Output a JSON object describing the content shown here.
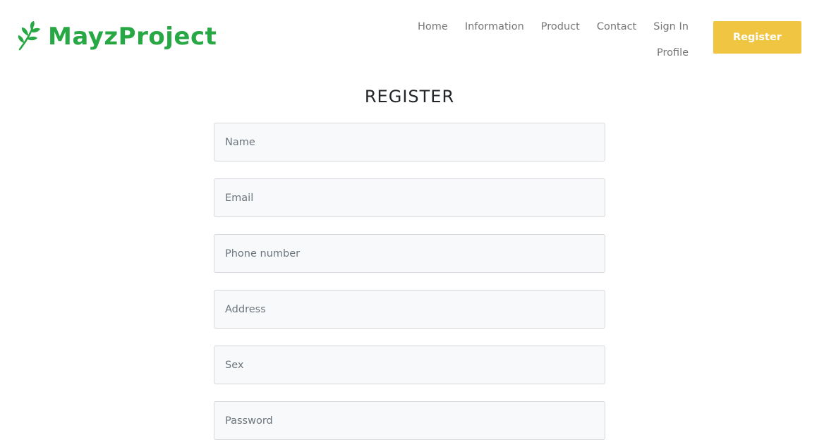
{
  "brand": {
    "name": "MayzProject",
    "icon": "leaf-sprig-icon",
    "color": "#28a745"
  },
  "nav": {
    "items": [
      {
        "label": "Home"
      },
      {
        "label": "Information"
      },
      {
        "label": "Product"
      },
      {
        "label": "Contact"
      },
      {
        "label": "Sign In"
      },
      {
        "label": "Profile"
      }
    ],
    "color": "#777777"
  },
  "header_button": {
    "label": "Register",
    "color": "#f0c541"
  },
  "form": {
    "title": "REGISTER",
    "fields": [
      {
        "placeholder": "Name",
        "value": ""
      },
      {
        "placeholder": "Email",
        "value": ""
      },
      {
        "placeholder": "Phone number",
        "value": ""
      },
      {
        "placeholder": "Address",
        "value": ""
      },
      {
        "placeholder": "Sex",
        "value": ""
      },
      {
        "placeholder": "Password",
        "value": ""
      }
    ]
  }
}
